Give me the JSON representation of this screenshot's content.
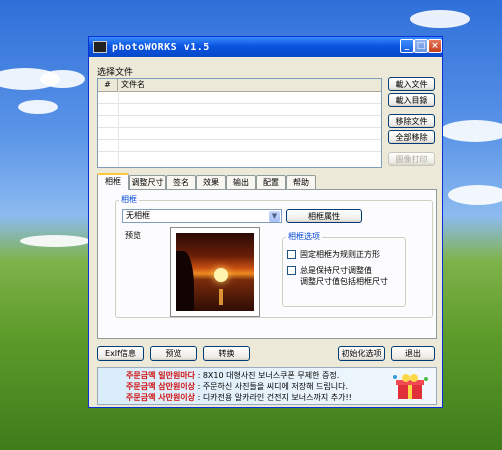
{
  "window": {
    "title": "photoWORKS v1.5"
  },
  "files": {
    "section_label": "选择文件",
    "columns": [
      "#",
      "文件名"
    ],
    "buttons": {
      "add_file": "載入文件",
      "add_dir": "載入目錄",
      "remove_file": "移除文件",
      "remove_all": "全部移除",
      "print": "圖像打印"
    }
  },
  "tabs": [
    "相框",
    "调整尺寸",
    "签名",
    "效果",
    "输出",
    "配置",
    "帮助"
  ],
  "frame": {
    "group_label": "相框",
    "select_value": "无相框",
    "props_button": "相框属性",
    "preview_label": "预览",
    "options_label": "相框选项",
    "option1": "固定相框为规则正方形",
    "option2_line1": "总是保持尺寸调整值",
    "option2_line2": "调整尺寸值包括相框尺寸"
  },
  "bottom_buttons": {
    "exif": "ExIf信息",
    "preview": "预览",
    "convert": "转换",
    "reset": "初始化选项",
    "exit": "退出"
  },
  "banner": {
    "lines": [
      {
        "red": "주문금액 일만원마다",
        "text": " : 8X10 대형사진 보너스쿠폰 무제한 증정."
      },
      {
        "red": "주문금액 삼만원이상",
        "text": " : 주문하신 사진들을 씨디에 저장해 드립니다."
      },
      {
        "red": "주문금액 사만원이상",
        "text": " : 디카전용 알카라인 건전지 보너스까지 추가!!"
      }
    ]
  }
}
